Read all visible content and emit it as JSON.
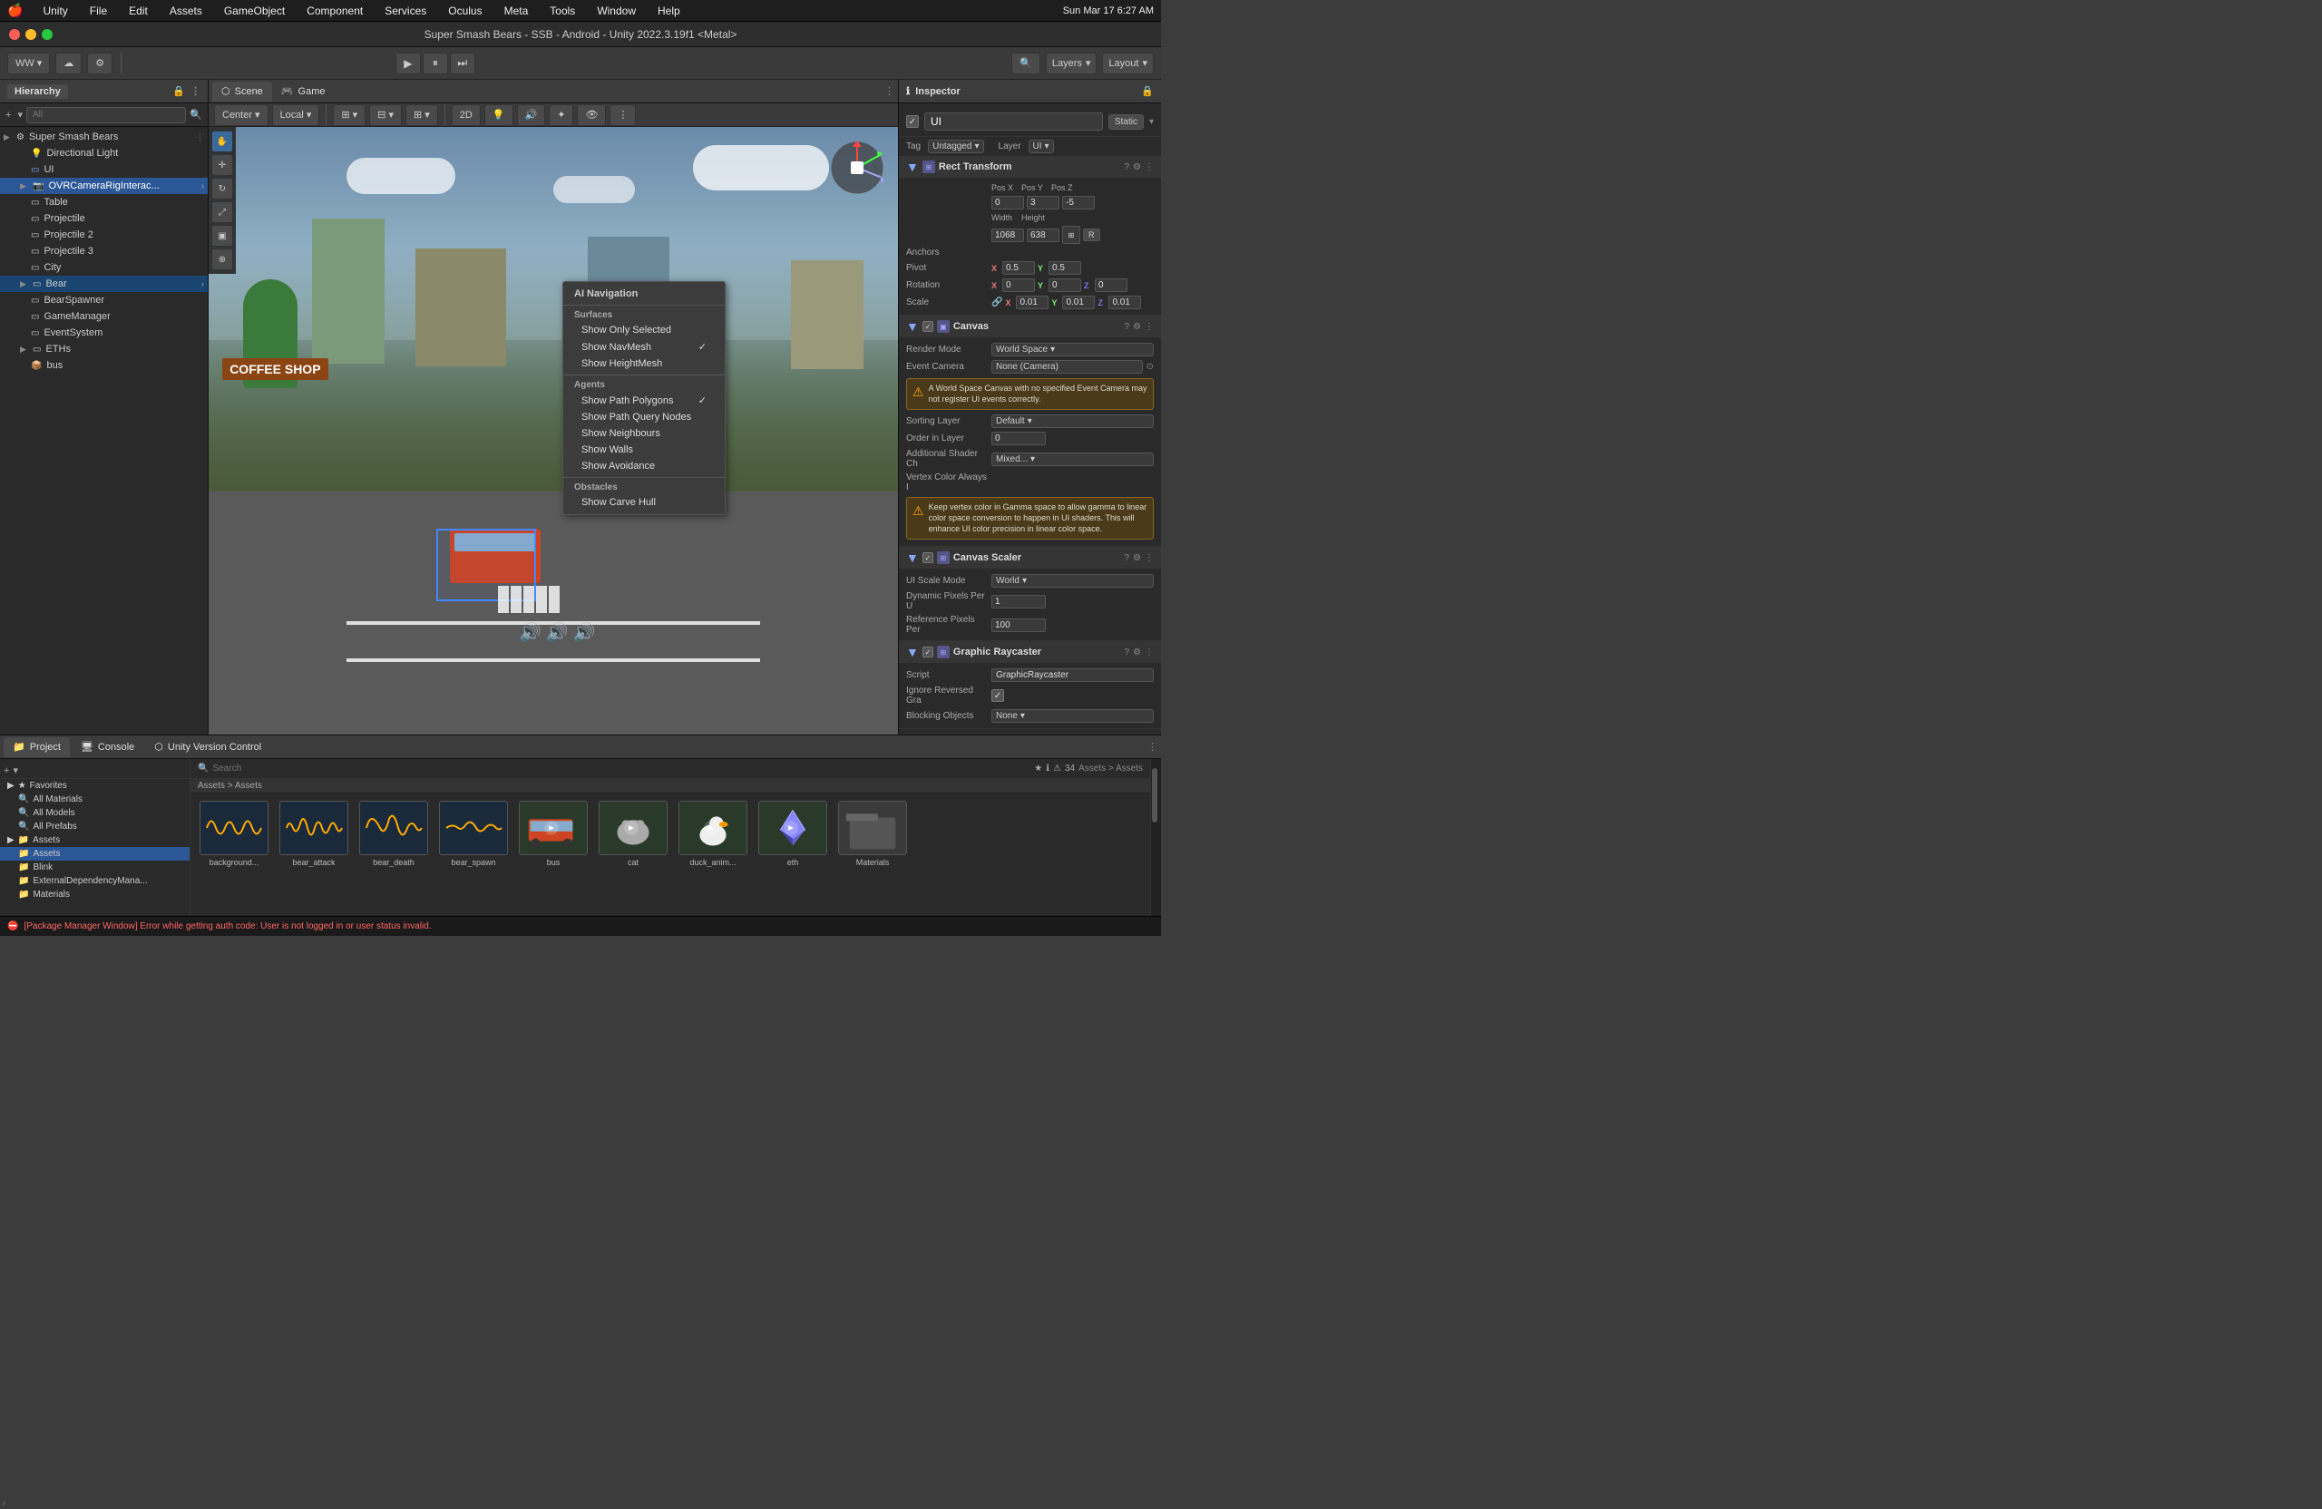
{
  "app": {
    "title": "Super Smash Bears - SSB - Android - Unity 2022.3.19f1 <Metal>",
    "time": "Sun Mar 17  6:27 AM"
  },
  "menubar": {
    "apple": "🍎",
    "items": [
      "Unity",
      "File",
      "Edit",
      "Assets",
      "GameObject",
      "Component",
      "Services",
      "Oculus",
      "Meta",
      "Tools",
      "Window",
      "Help"
    ]
  },
  "toolbar": {
    "ww_btn": "WW",
    "layers_label": "Layers",
    "layout_label": "Layout",
    "play": "▶",
    "pause": "⏸",
    "step": "⏭",
    "center_btn": "Center",
    "local_btn": "Local"
  },
  "hierarchy": {
    "title": "Hierarchy",
    "search_placeholder": "All",
    "items": [
      {
        "name": "Super Smash Bears",
        "depth": 0,
        "icon": "⚙",
        "has_arrow": true,
        "selected": false
      },
      {
        "name": "Directional Light",
        "depth": 1,
        "icon": "💡",
        "has_arrow": false,
        "selected": false
      },
      {
        "name": "UI",
        "depth": 1,
        "icon": "▭",
        "has_arrow": false,
        "selected": false
      },
      {
        "name": "OVRCameraRigInterac...",
        "depth": 1,
        "icon": "📷",
        "has_arrow": true,
        "selected": true
      },
      {
        "name": "Table",
        "depth": 1,
        "icon": "▭",
        "has_arrow": false,
        "selected": false
      },
      {
        "name": "Projectile",
        "depth": 1,
        "icon": "▭",
        "has_arrow": false,
        "selected": false
      },
      {
        "name": "Projectile 2",
        "depth": 1,
        "icon": "▭",
        "has_arrow": false,
        "selected": false
      },
      {
        "name": "Projectile 3",
        "depth": 1,
        "icon": "▭",
        "has_arrow": false,
        "selected": false
      },
      {
        "name": "City",
        "depth": 1,
        "icon": "▭",
        "has_arrow": false,
        "selected": false
      },
      {
        "name": "Bear",
        "depth": 1,
        "icon": "▭",
        "has_arrow": true,
        "selected": false
      },
      {
        "name": "BearSpawner",
        "depth": 1,
        "icon": "▭",
        "has_arrow": false,
        "selected": false
      },
      {
        "name": "GameManager",
        "depth": 1,
        "icon": "▭",
        "has_arrow": false,
        "selected": false
      },
      {
        "name": "EventSystem",
        "depth": 1,
        "icon": "▭",
        "has_arrow": false,
        "selected": false
      },
      {
        "name": "ETHs",
        "depth": 1,
        "icon": "▭",
        "has_arrow": true,
        "selected": false
      },
      {
        "name": "bus",
        "depth": 1,
        "icon": "📦",
        "has_arrow": false,
        "selected": false
      }
    ]
  },
  "scene": {
    "tabs": [
      "Scene",
      "Game"
    ],
    "active_tab": "Scene"
  },
  "context_menu": {
    "header": "AI Navigation",
    "sections": [
      {
        "title": "Surfaces",
        "items": [
          {
            "label": "Show Only Selected",
            "checked": false
          },
          {
            "label": "Show NavMesh",
            "checked": true
          },
          {
            "label": "Show HeightMesh",
            "checked": false
          }
        ]
      },
      {
        "title": "Agents",
        "items": [
          {
            "label": "Show Path Polygons",
            "checked": true
          },
          {
            "label": "Show Path Query Nodes",
            "checked": false
          },
          {
            "label": "Show Neighbours",
            "checked": false
          },
          {
            "label": "Show Walls",
            "checked": false
          },
          {
            "label": "Show Avoidance",
            "checked": false
          }
        ]
      },
      {
        "title": "Obstacles",
        "items": [
          {
            "label": "Show Carve Hull",
            "checked": false
          }
        ]
      }
    ]
  },
  "inspector": {
    "title": "Inspector",
    "object_name": "UI",
    "tag": "Untagged",
    "layer": "UI",
    "static_btn": "Static",
    "rect_transform": {
      "title": "Rect Transform",
      "pos_x": "0",
      "pos_y": "3",
      "pos_z": "-5",
      "width": "1068",
      "height": "638",
      "pivot_x": "0.5",
      "pivot_y": "0.5",
      "rotation_x": "0",
      "rotation_y": "0",
      "rotation_z": "0",
      "scale_x": "0.01",
      "scale_y": "0.01",
      "scale_z": "0.01"
    },
    "canvas": {
      "title": "Canvas",
      "render_mode": "World Space",
      "event_camera": "None (Camera)",
      "warning": "A World Space Canvas with no specified Event Camera may not register UI events correctly.",
      "sorting_layer": "Default",
      "order_in_layer": "0",
      "additional_shader": "Mixed...",
      "vertex_color_label": "Vertex Color Always I"
    },
    "vertex_warning": "Keep vertex color in Gamma space to allow gamma to linear color space conversion to happen in UI shaders. This will enhance UI color precision in linear color space.",
    "canvas_scaler": {
      "title": "Canvas Scaler",
      "ui_scale_mode": "World",
      "dynamic_pixels": "1",
      "reference_pixels": "100"
    },
    "graphic_raycaster": {
      "title": "Graphic Raycaster",
      "script": "GraphicRaycaster",
      "ignore_reversed": "✓",
      "blocking_objects": "None"
    }
  },
  "bottom": {
    "tabs": [
      "Project",
      "Console",
      "Unity Version Control"
    ],
    "active_tab": "Project",
    "breadcrumb": "Assets > Assets",
    "folders": [
      {
        "name": "Favorites",
        "depth": 0,
        "is_group": true
      },
      {
        "name": "All Materials",
        "depth": 1
      },
      {
        "name": "All Models",
        "depth": 1
      },
      {
        "name": "All Prefabs",
        "depth": 1
      },
      {
        "name": "Assets",
        "depth": 0,
        "is_group": true
      },
      {
        "name": "Assets",
        "depth": 1,
        "selected": true
      },
      {
        "name": "Blink",
        "depth": 1
      },
      {
        "name": "ExternalDependencyMana...",
        "depth": 1
      },
      {
        "name": "Materials",
        "depth": 1
      }
    ],
    "assets": [
      {
        "name": "background...",
        "type": "audio"
      },
      {
        "name": "bear_attack",
        "type": "audio"
      },
      {
        "name": "bear_death",
        "type": "audio"
      },
      {
        "name": "bear_spawn",
        "type": "audio"
      },
      {
        "name": "bus",
        "type": "prefab"
      },
      {
        "name": "cat",
        "type": "prefab"
      },
      {
        "name": "duck_anim...",
        "type": "prefab"
      },
      {
        "name": "eth",
        "type": "prefab"
      },
      {
        "name": "Materials",
        "type": "folder"
      }
    ],
    "item_count": "34"
  },
  "status_bar": {
    "message": "[Package Manager Window] Error while getting auth code: User is not logged in or user status invalid."
  }
}
